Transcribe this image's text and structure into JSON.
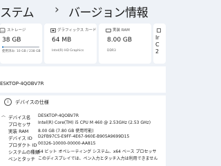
{
  "breadcrumb": {
    "parent": "ステム",
    "separator": "›",
    "title": "バージョン情報"
  },
  "cards": [
    {
      "icon": "storage-icon",
      "label": "ストレージ",
      "value": "38 GB",
      "sub": "使用済み: 10 GB / 238 GB",
      "progress": 0.042,
      "has_progress": true
    },
    {
      "icon": "graphics-card-icon",
      "label": "グラフィックス カード",
      "value": "64 MB",
      "sub": "Intel(R) HD Graphics"
    },
    {
      "icon": "ram-icon",
      "label": "実装 RAM",
      "value": "8.00 GB",
      "sub": "DDR3"
    },
    {
      "icon": "processor-icon",
      "label": "",
      "value": "Ir",
      "value2": "C",
      "value3": "2"
    }
  ],
  "device": {
    "name": "ESKTOP-4QOBV7R"
  },
  "specs": {
    "title": "デバイスの仕様",
    "rows": [
      {
        "label": "デバイス名",
        "value": "DESKTOP-4QOBV7R"
      },
      {
        "label": "プロセッサ",
        "value": "Intel(R) Core(TM) i5 CPU      M 460  @ 2.53GHz (2.53 GHz)"
      },
      {
        "label": "実装 RAM",
        "value": "8.00 GB (7.80 GB 使用可能)"
      },
      {
        "label": "デバイス ID",
        "value": "D2FB97C5-E9FF-4E67-960E-B905A9699D15"
      },
      {
        "label": "プロダクト ID",
        "value": "00326-10000-00000-AA815"
      },
      {
        "label": "システムの種類",
        "value": "64 ビット オペレーティング システム、x64 ベース プロセッサ"
      },
      {
        "label": "ペンとタッチ",
        "value": "このディスプレイでは、ペン入力とタッチ入力は利用できません"
      }
    ]
  },
  "colors": {
    "accent": "#0067c0",
    "background": "#eef2f7",
    "card": "#ffffff"
  }
}
